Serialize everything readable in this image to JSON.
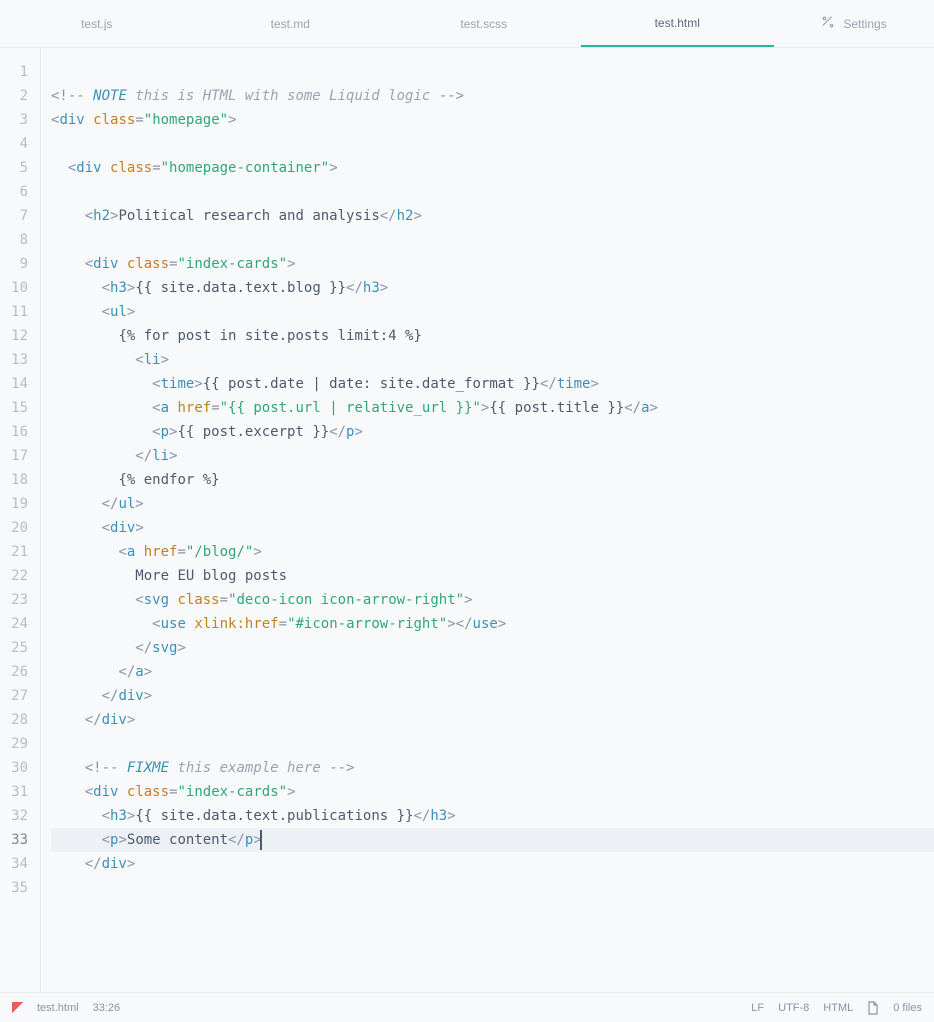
{
  "tabs": [
    {
      "label": "test.js"
    },
    {
      "label": "test.md"
    },
    {
      "label": "test.scss"
    },
    {
      "label": "test.html"
    }
  ],
  "activeTab": 3,
  "settingsLabel": "Settings",
  "statusbar": {
    "filename": "test.html",
    "position": "33:26",
    "lineEnding": "LF",
    "encoding": "UTF-8",
    "lang": "HTML",
    "fileCount": "0 files"
  },
  "gutter": {
    "start": 1,
    "end": 35,
    "current": 33
  },
  "code": {
    "comment1_kw": "NOTE",
    "comment1_rest": " this is HTML with some Liquid logic ",
    "str_homepage": "\"homepage\"",
    "str_homepage_container": "\"homepage-container\"",
    "h2_text": "Political research and analysis",
    "str_index_cards": "\"index-cards\"",
    "liq_blog": "{{ site.data.text.blog }}",
    "liq_for": "{% for post in site.posts limit:4 %}",
    "liq_date": "{{ post.date | date: site.date_format }}",
    "liq_url": "\"{{ post.url | relative_url }}\"",
    "liq_title": "{{ post.title }}",
    "liq_excerpt": "{{ post.excerpt }}",
    "liq_endfor": "{% endfor %}",
    "str_blog_href": "\"/blog/\"",
    "more_text": "More EU blog posts",
    "str_deco": "\"deco-icon icon-arrow-right\"",
    "str_xlink": "\"#icon-arrow-right\"",
    "comment2_kw": "FIXME",
    "comment2_rest": " this example here ",
    "liq_pub": "{{ site.data.text.publications }}",
    "p_text": "Some content"
  }
}
